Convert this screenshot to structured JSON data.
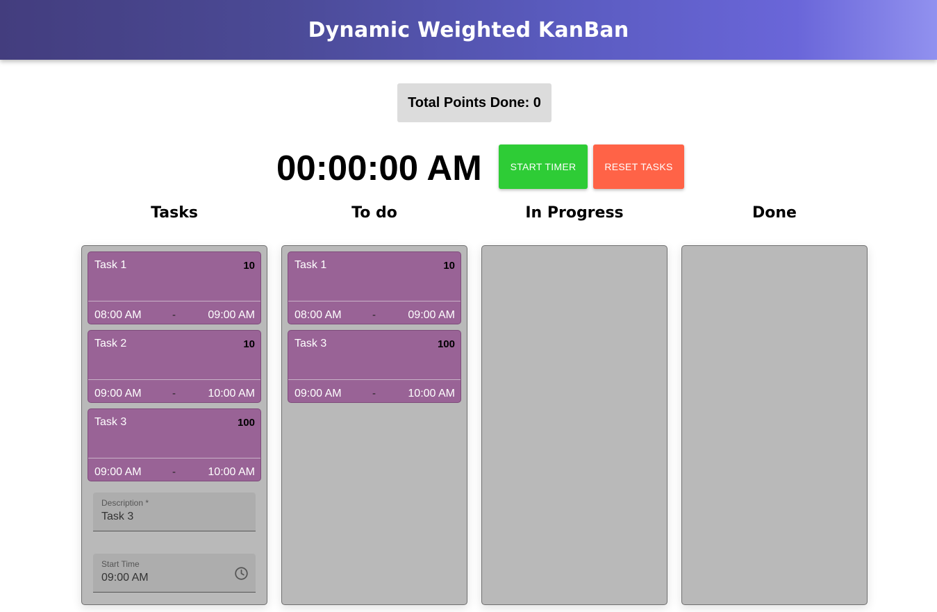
{
  "header": {
    "title": "Dynamic Weighted KanBan"
  },
  "summary": {
    "points_label": "Total Points Done: 0"
  },
  "timer": {
    "display": "00:00:00 AM",
    "start_label": "START TIMER",
    "reset_label": "RESET TASKS",
    "start_color": "#2ecc36",
    "reset_color": "#ff6347"
  },
  "columns": [
    {
      "title": "Tasks",
      "cards": [
        {
          "name": "Task 1",
          "points": "10",
          "start": "08:00 AM",
          "sep": "-",
          "end": "09:00 AM"
        },
        {
          "name": "Task 2",
          "points": "10",
          "start": "09:00 AM",
          "sep": "-",
          "end": "10:00 AM"
        },
        {
          "name": "Task 3",
          "points": "100",
          "start": "09:00 AM",
          "sep": "-",
          "end": "10:00 AM"
        }
      ],
      "form": {
        "description_label": "Description *",
        "description_value": "Task 3",
        "start_time_label": "Start Time",
        "start_time_value": "09:00 AM",
        "start_time_icon": "clock-icon"
      }
    },
    {
      "title": "To do",
      "cards": [
        {
          "name": "Task 1",
          "points": "10",
          "start": "08:00 AM",
          "sep": "-",
          "end": "09:00 AM"
        },
        {
          "name": "Task 3",
          "points": "100",
          "start": "09:00 AM",
          "sep": "-",
          "end": "10:00 AM"
        }
      ]
    },
    {
      "title": "In Progress",
      "cards": []
    },
    {
      "title": "Done",
      "cards": []
    }
  ],
  "colors": {
    "card_bg": "#996396",
    "column_bg": "#b9b9b9"
  }
}
